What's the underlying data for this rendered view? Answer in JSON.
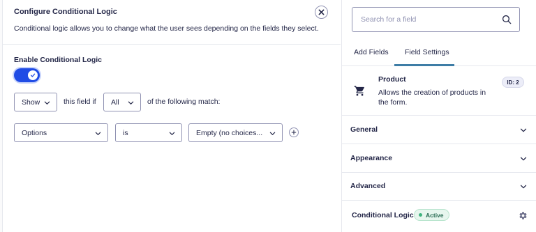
{
  "flyout": {
    "title": "Configure Conditional Logic",
    "description": "Conditional logic allows you to change what the user sees depending on the fields they select.",
    "close_icon": "close-icon",
    "enable_label": "Enable Conditional Logic",
    "enabled": true,
    "action_select": "Show",
    "field_if_text": "this field if",
    "match_select": "All",
    "following_text": "of the following match:",
    "rule": {
      "field": "Options",
      "operator": "is",
      "value": "Empty (no choices..."
    },
    "add_rule_icon": "plus-icon"
  },
  "sidebar": {
    "search_placeholder": "Search for a field",
    "tabs": [
      {
        "label": "Add Fields",
        "active": false
      },
      {
        "label": "Field Settings",
        "active": true
      }
    ],
    "field": {
      "icon": "cart-icon",
      "name": "Product",
      "description": "Allows the creation of products in the form.",
      "id_badge": "ID: 2"
    },
    "accordions": [
      {
        "label": "General"
      },
      {
        "label": "Appearance"
      },
      {
        "label": "Advanced"
      }
    ],
    "conditional_logic": {
      "label": "Conditional Logic",
      "status": "Active",
      "icon": "gear-icon"
    }
  },
  "colors": {
    "accent": "#204ce5",
    "tab_underline": "#3e7da6",
    "text": "#242748",
    "border": "#9092b2",
    "active_badge_bg": "#e7f6ee",
    "active_badge_text": "#276a52"
  }
}
